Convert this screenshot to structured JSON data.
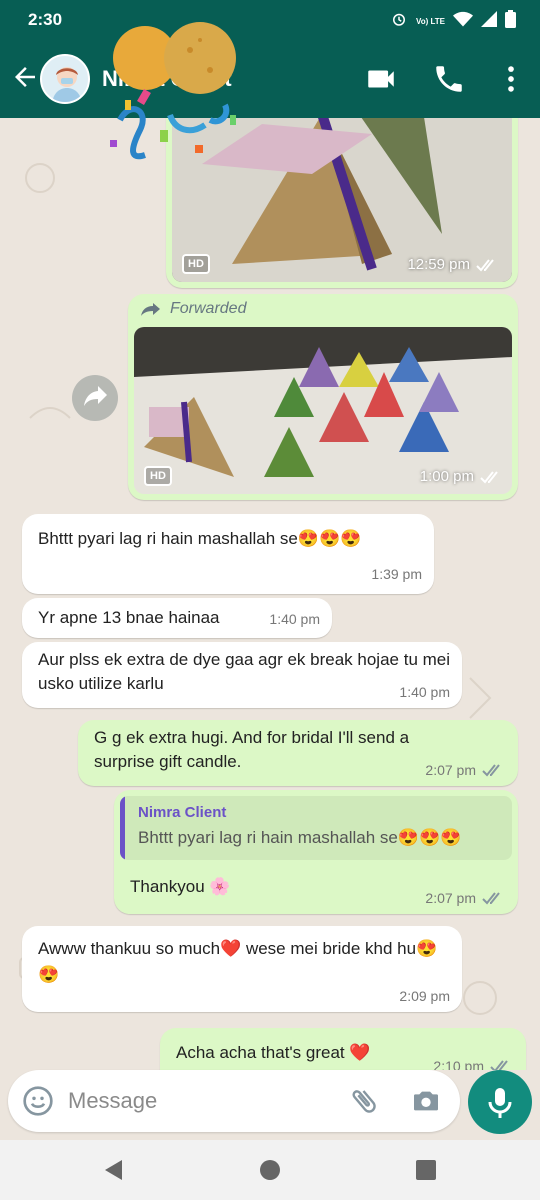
{
  "status_bar": {
    "time": "2:30",
    "lte_label": "Vo) LTE"
  },
  "header": {
    "contact_name": "Nimra Client"
  },
  "colors": {
    "brand": "#075e54",
    "outgoing": "#dcf8c6",
    "incoming": "#ffffff",
    "accent": "#128c7e"
  },
  "icons": [
    "back-arrow-icon",
    "video-call-icon",
    "phone-icon",
    "more-vert-icon",
    "share-icon",
    "emoji-icon",
    "attach-icon",
    "camera-icon",
    "mic-icon"
  ],
  "messages": [
    {
      "time": "12:59 pm",
      "hd": "HD"
    },
    {
      "forwarded": "Forwarded",
      "time": "1:00 pm",
      "hd": "HD"
    },
    {
      "text": "Bhttt pyari lag ri hain mashallah se😍😍😍",
      "time": "1:39 pm"
    },
    {
      "text": "Yr apne 13 bnae hainaa",
      "time": "1:40 pm"
    },
    {
      "text": "Aur plss ek extra de dye gaa agr ek break hojae tu mei usko utilize karlu",
      "time": "1:40 pm"
    },
    {
      "text": "G g ek extra hugi. And for bridal I'll send a surprise gift candle.",
      "time": "2:07 pm"
    },
    {
      "quote_name": "Nimra Client",
      "quote_text": "Bhttt pyari lag ri hain mashallah se😍😍😍",
      "text": "Thankyou 🌸",
      "time": "2:07 pm"
    },
    {
      "text": "Awww thankuu so much❤️ wese mei bride khd hu😍😍",
      "time": "2:09 pm"
    },
    {
      "text": "Acha acha that's great ❤️",
      "time": "2:10 pm"
    }
  ],
  "composer": {
    "placeholder": "Message"
  }
}
